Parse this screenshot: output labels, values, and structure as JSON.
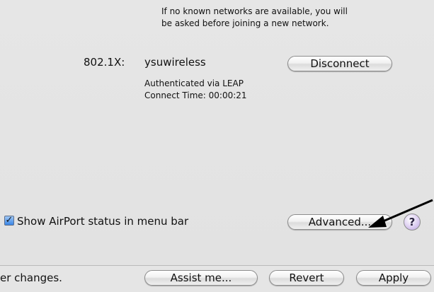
{
  "info": {
    "line1": "If no known networks are available, you will",
    "line2": "be asked before joining a new network."
  },
  "connection": {
    "type_label": "802.1X:",
    "network_name": "ysuwireless",
    "auth_status": "Authenticated via LEAP",
    "connect_time": "Connect Time: 00:00:21",
    "disconnect_label": "Disconnect"
  },
  "status_checkbox": {
    "checked": true,
    "check_glyph": "✓",
    "label": "Show AirPort status in menu bar"
  },
  "advanced_label": "Advanced...",
  "help_label": "?",
  "bottom": {
    "changes_text": "er changes.",
    "assist_label": "Assist me...",
    "revert_label": "Revert",
    "apply_label": "Apply"
  }
}
